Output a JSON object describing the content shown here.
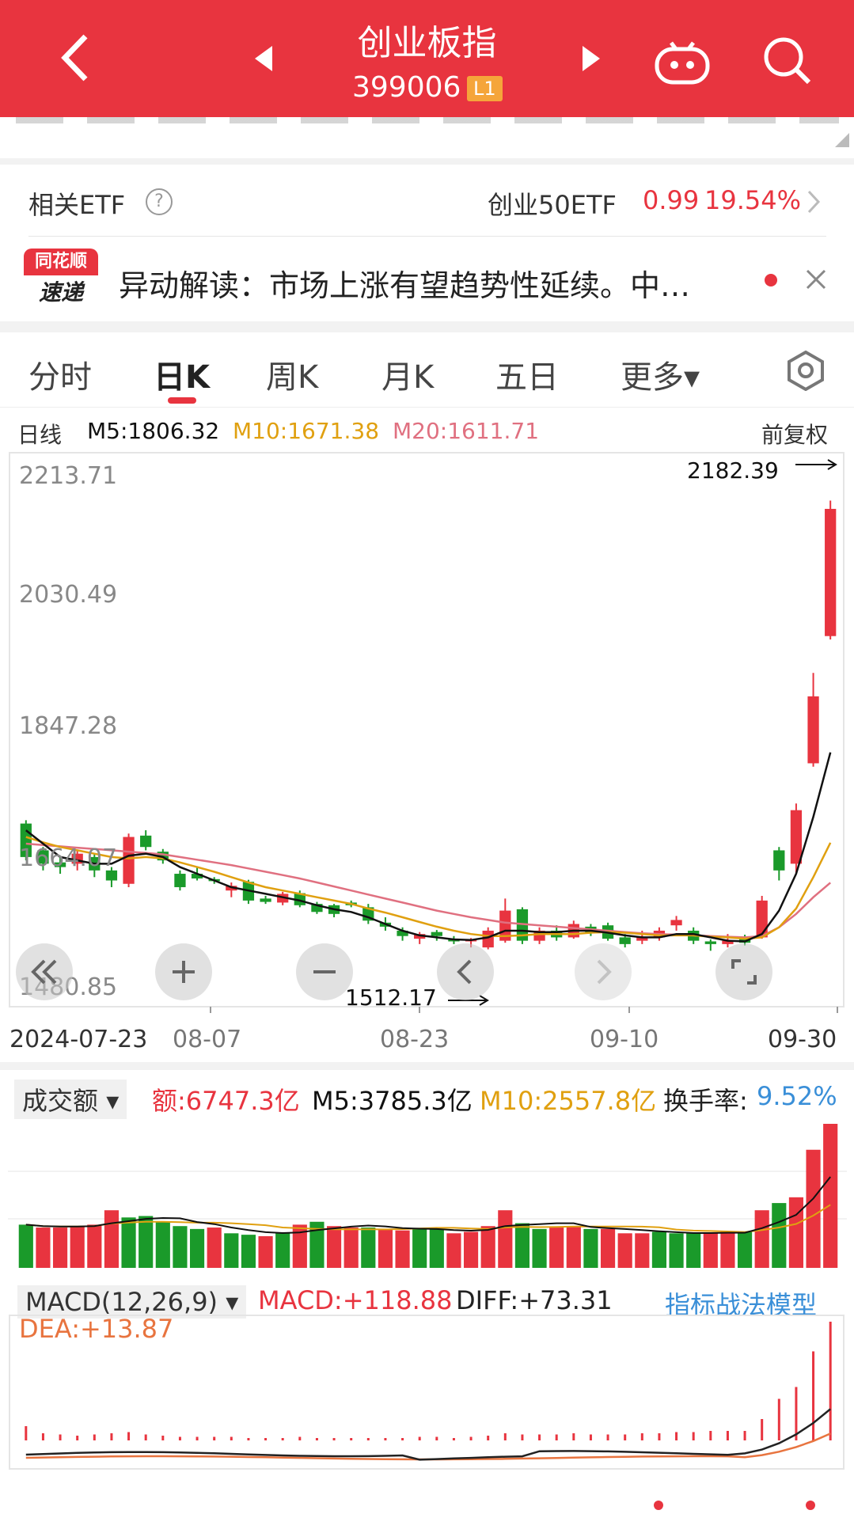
{
  "header": {
    "title": "创业板指",
    "code": "399006",
    "level_badge": "L1"
  },
  "etf": {
    "label": "相关ETF",
    "help": "?",
    "name": "创业50ETF",
    "price": "0.99",
    "change_pct": "19.54%"
  },
  "news": {
    "logo_top": "同花顺",
    "logo_bottom": "速递",
    "text": "异动解读：市场上涨有望趋势性延续。中…"
  },
  "tabs": [
    "分时",
    "日K",
    "周K",
    "月K",
    "五日",
    "更多▾"
  ],
  "active_tab": 1,
  "ma_legend": {
    "period": "日线",
    "m5": "M5:1806.32",
    "m10": "M10:1671.38",
    "m20": "M20:1611.71",
    "adjust": "前复权"
  },
  "colors": {
    "up": "#e8343f",
    "down": "#1a9a2a",
    "m5": "#111111",
    "m10": "#e0a010",
    "m20": "#e07080",
    "accent": "#e8343f",
    "blue": "#3a8fd8",
    "dea": "#e8743f"
  },
  "price_axis": [
    "2213.71",
    "2030.49",
    "1847.28",
    "1664.07",
    "1480.85"
  ],
  "annotations": {
    "high": "2182.39",
    "low": "1512.17"
  },
  "date_axis": [
    "2024-07-23",
    "08-07",
    "08-23",
    "09-10",
    "09-30"
  ],
  "volume_legend": {
    "selector": "成交额",
    "amount": "额:6747.3亿",
    "m5": "M5:3785.3亿",
    "m10": "M10:2557.8亿",
    "turnover_label": "换手率:",
    "turnover_value": "9.52%"
  },
  "macd_legend": {
    "selector": "MACD(12,26,9)",
    "macd": "MACD:+118.88",
    "diff": "DIFF:+73.31",
    "dea": "DEA:+13.87",
    "model_link": "指标战法模型"
  },
  "chart_data": {
    "type": "candlestick",
    "ylim": [
      1480.85,
      2213.71
    ],
    "candles": [
      {
        "o": 1700,
        "c": 1650,
        "h": 1705,
        "l": 1645
      },
      {
        "o": 1660,
        "c": 1640,
        "h": 1665,
        "l": 1630
      },
      {
        "o": 1642,
        "c": 1635,
        "h": 1650,
        "l": 1625
      },
      {
        "o": 1640,
        "c": 1655,
        "h": 1660,
        "l": 1630
      },
      {
        "o": 1650,
        "c": 1630,
        "h": 1655,
        "l": 1620
      },
      {
        "o": 1630,
        "c": 1615,
        "h": 1635,
        "l": 1605
      },
      {
        "o": 1610,
        "c": 1680,
        "h": 1685,
        "l": 1605
      },
      {
        "o": 1682,
        "c": 1665,
        "h": 1690,
        "l": 1660
      },
      {
        "o": 1658,
        "c": 1645,
        "h": 1662,
        "l": 1640
      },
      {
        "o": 1625,
        "c": 1605,
        "h": 1630,
        "l": 1600
      },
      {
        "o": 1625,
        "c": 1618,
        "h": 1635,
        "l": 1615
      },
      {
        "o": 1617,
        "c": 1614,
        "h": 1620,
        "l": 1610
      },
      {
        "o": 1600,
        "c": 1607,
        "h": 1612,
        "l": 1590
      },
      {
        "o": 1613,
        "c": 1585,
        "h": 1616,
        "l": 1580
      },
      {
        "o": 1588,
        "c": 1583,
        "h": 1592,
        "l": 1580
      },
      {
        "o": 1582,
        "c": 1595,
        "h": 1598,
        "l": 1578
      },
      {
        "o": 1596,
        "c": 1578,
        "h": 1600,
        "l": 1575
      },
      {
        "o": 1580,
        "c": 1568,
        "h": 1583,
        "l": 1565
      },
      {
        "o": 1578,
        "c": 1565,
        "h": 1580,
        "l": 1560
      },
      {
        "o": 1582,
        "c": 1578,
        "h": 1585,
        "l": 1575
      },
      {
        "o": 1575,
        "c": 1555,
        "h": 1580,
        "l": 1550
      },
      {
        "o": 1552,
        "c": 1546,
        "h": 1560,
        "l": 1540
      },
      {
        "o": 1540,
        "c": 1532,
        "h": 1545,
        "l": 1525
      },
      {
        "o": 1528,
        "c": 1535,
        "h": 1538,
        "l": 1520
      },
      {
        "o": 1538,
        "c": 1532,
        "h": 1541,
        "l": 1525
      },
      {
        "o": 1528,
        "c": 1524,
        "h": 1532,
        "l": 1520
      },
      {
        "o": 1524,
        "c": 1527,
        "h": 1529,
        "l": 1515
      },
      {
        "o": 1515,
        "c": 1540,
        "h": 1545,
        "l": 1512.17
      },
      {
        "o": 1525,
        "c": 1570,
        "h": 1588,
        "l": 1522
      },
      {
        "o": 1572,
        "c": 1525,
        "h": 1575,
        "l": 1520
      },
      {
        "o": 1525,
        "c": 1540,
        "h": 1545,
        "l": 1520
      },
      {
        "o": 1540,
        "c": 1530,
        "h": 1548,
        "l": 1525
      },
      {
        "o": 1530,
        "c": 1550,
        "h": 1555,
        "l": 1528
      },
      {
        "o": 1546,
        "c": 1536,
        "h": 1550,
        "l": 1532
      },
      {
        "o": 1548,
        "c": 1528,
        "h": 1552,
        "l": 1525
      },
      {
        "o": 1530,
        "c": 1520,
        "h": 1535,
        "l": 1515
      },
      {
        "o": 1525,
        "c": 1530,
        "h": 1540,
        "l": 1520
      },
      {
        "o": 1530,
        "c": 1540,
        "h": 1545,
        "l": 1525
      },
      {
        "o": 1548,
        "c": 1556,
        "h": 1562,
        "l": 1540
      },
      {
        "o": 1540,
        "c": 1525,
        "h": 1545,
        "l": 1520
      },
      {
        "o": 1524,
        "c": 1520,
        "h": 1527,
        "l": 1510
      },
      {
        "o": 1520,
        "c": 1525,
        "h": 1535,
        "l": 1515
      },
      {
        "o": 1528,
        "c": 1522,
        "h": 1534,
        "l": 1518
      },
      {
        "o": 1530,
        "c": 1585,
        "h": 1592,
        "l": 1528
      },
      {
        "o": 1660,
        "c": 1630,
        "h": 1665,
        "l": 1615
      },
      {
        "o": 1640,
        "c": 1720,
        "h": 1730,
        "l": 1625
      },
      {
        "o": 1790,
        "c": 1890,
        "h": 1925,
        "l": 1785
      },
      {
        "o": 1980,
        "c": 2170,
        "h": 2182.39,
        "l": 1975
      }
    ],
    "volume": [
      {
        "v": 30,
        "up": false
      },
      {
        "v": 28,
        "up": true
      },
      {
        "v": 28,
        "up": true
      },
      {
        "v": 29,
        "up": true
      },
      {
        "v": 30,
        "up": true
      },
      {
        "v": 40,
        "up": true
      },
      {
        "v": 35,
        "up": false
      },
      {
        "v": 36,
        "up": false
      },
      {
        "v": 32,
        "up": false
      },
      {
        "v": 29,
        "up": false
      },
      {
        "v": 27,
        "up": false
      },
      {
        "v": 28,
        "up": true
      },
      {
        "v": 24,
        "up": false
      },
      {
        "v": 23,
        "up": false
      },
      {
        "v": 22,
        "up": true
      },
      {
        "v": 24,
        "up": false
      },
      {
        "v": 30,
        "up": true
      },
      {
        "v": 32,
        "up": false
      },
      {
        "v": 29,
        "up": true
      },
      {
        "v": 28,
        "up": true
      },
      {
        "v": 28,
        "up": false
      },
      {
        "v": 27,
        "up": true
      },
      {
        "v": 26,
        "up": true
      },
      {
        "v": 27,
        "up": false
      },
      {
        "v": 27,
        "up": false
      },
      {
        "v": 24,
        "up": true
      },
      {
        "v": 25,
        "up": true
      },
      {
        "v": 29,
        "up": true
      },
      {
        "v": 40,
        "up": true
      },
      {
        "v": 31,
        "up": false
      },
      {
        "v": 27,
        "up": false
      },
      {
        "v": 28,
        "up": true
      },
      {
        "v": 29,
        "up": true
      },
      {
        "v": 27,
        "up": false
      },
      {
        "v": 27,
        "up": true
      },
      {
        "v": 24,
        "up": true
      },
      {
        "v": 24,
        "up": true
      },
      {
        "v": 25,
        "up": false
      },
      {
        "v": 24,
        "up": false
      },
      {
        "v": 24,
        "up": false
      },
      {
        "v": 24,
        "up": true
      },
      {
        "v": 25,
        "up": true
      },
      {
        "v": 25,
        "up": false
      },
      {
        "v": 40,
        "up": true
      },
      {
        "v": 45,
        "up": false
      },
      {
        "v": 49,
        "up": true
      },
      {
        "v": 82,
        "up": true
      },
      {
        "v": 100,
        "up": true
      }
    ],
    "macd_hist": [
      12,
      6,
      5,
      4,
      5,
      6,
      7,
      5,
      4,
      3,
      3,
      3,
      3,
      2,
      2,
      2,
      3,
      2,
      2,
      2,
      2,
      2,
      2,
      3,
      3,
      2,
      3,
      4,
      6,
      5,
      5,
      5,
      6,
      5,
      5,
      5,
      6,
      6,
      7,
      7,
      8,
      8,
      8,
      18,
      35,
      45,
      75,
      100
    ],
    "m5_line": [
      1690,
      1670,
      1650,
      1645,
      1640,
      1640,
      1652,
      1655,
      1650,
      1635,
      1625,
      1615,
      1605,
      1600,
      1595,
      1590,
      1585,
      1578,
      1572,
      1568,
      1560,
      1550,
      1540,
      1533,
      1530,
      1527,
      1526,
      1530,
      1540,
      1540,
      1538,
      1538,
      1540,
      1540,
      1537,
      1533,
      1530,
      1530,
      1535,
      1535,
      1530,
      1525,
      1524,
      1535,
      1570,
      1625,
      1710,
      1806.32
    ],
    "m10_line": [
      1680,
      1672,
      1665,
      1660,
      1655,
      1650,
      1648,
      1650,
      1648,
      1642,
      1635,
      1628,
      1620,
      1612,
      1605,
      1600,
      1595,
      1590,
      1585,
      1580,
      1573,
      1567,
      1560,
      1553,
      1546,
      1540,
      1535,
      1532,
      1532,
      1533,
      1535,
      1535,
      1535,
      1537,
      1538,
      1537,
      1535,
      1533,
      1533,
      1533,
      1531,
      1530,
      1528,
      1530,
      1545,
      1573,
      1620,
      1671.38
    ],
    "m20_line": [
      1670,
      1668,
      1666,
      1664,
      1662,
      1660,
      1658,
      1656,
      1654,
      1650,
      1646,
      1642,
      1638,
      1633,
      1628,
      1623,
      1618,
      1612,
      1606,
      1600,
      1594,
      1588,
      1582,
      1576,
      1570,
      1565,
      1560,
      1556,
      1552,
      1550,
      1548,
      1546,
      1544,
      1542,
      1540,
      1538,
      1536,
      1535,
      1534,
      1533,
      1532,
      1531,
      1530,
      1532,
      1545,
      1565,
      1590,
      1611.71
    ]
  }
}
